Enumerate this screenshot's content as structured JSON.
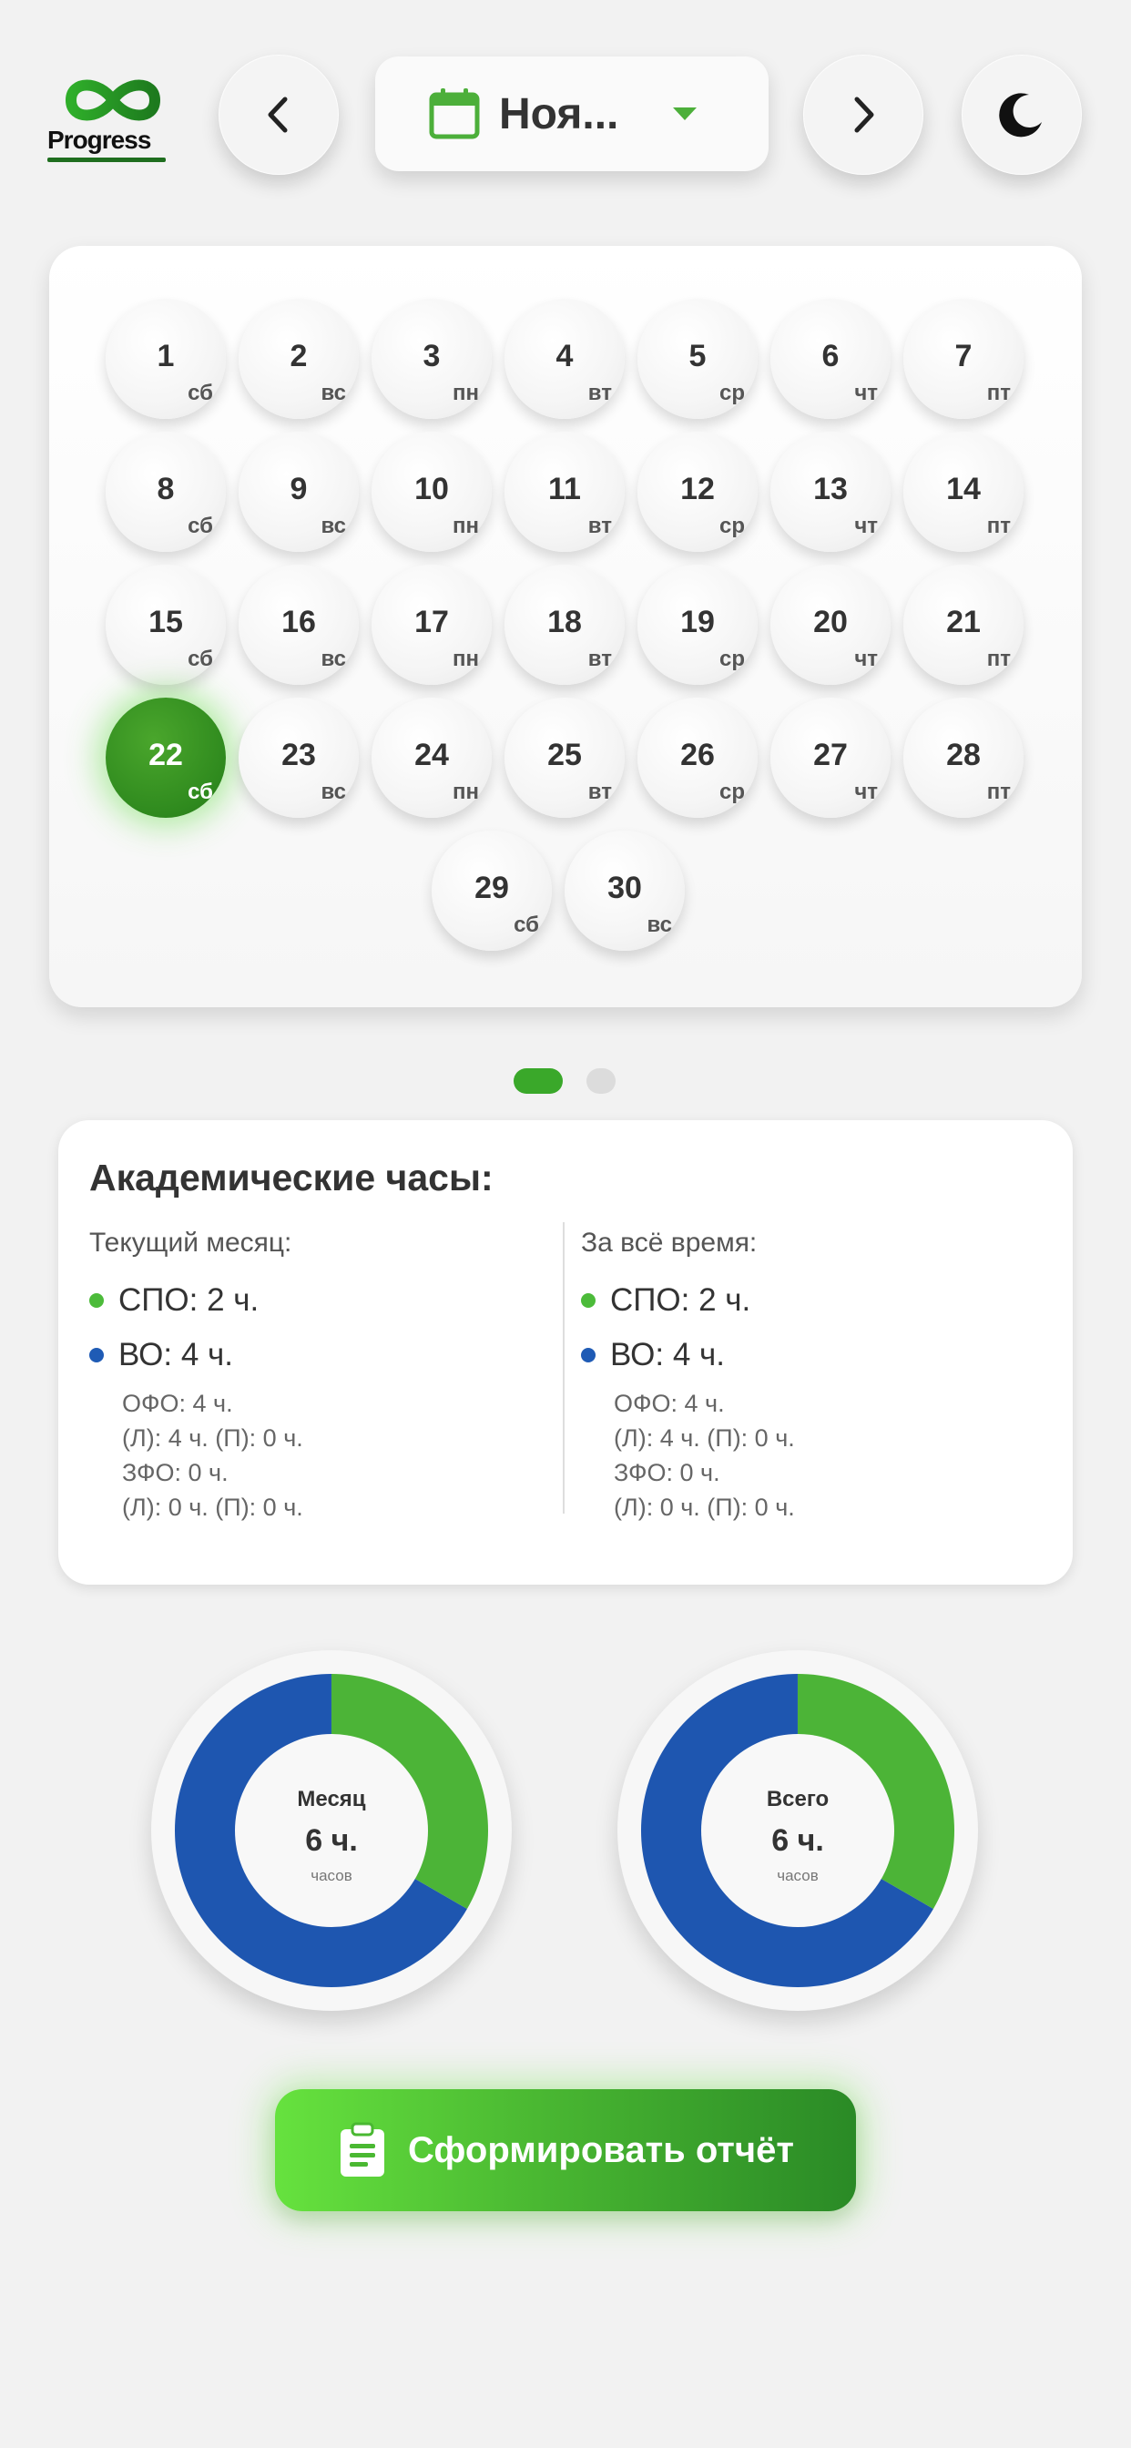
{
  "header": {
    "logo_text": "Progress",
    "month_label": "Ноя...",
    "prev_icon": "chevron-left-icon",
    "next_icon": "chevron-right-icon",
    "theme_icon": "moon-icon",
    "calendar_icon": "calendar-icon",
    "dropdown_icon": "caret-down-icon"
  },
  "calendar": {
    "days": [
      {
        "num": "1",
        "wd": "сб"
      },
      {
        "num": "2",
        "wd": "вс"
      },
      {
        "num": "3",
        "wd": "пн"
      },
      {
        "num": "4",
        "wd": "вт"
      },
      {
        "num": "5",
        "wd": "ср"
      },
      {
        "num": "6",
        "wd": "чт"
      },
      {
        "num": "7",
        "wd": "пт"
      },
      {
        "num": "8",
        "wd": "сб"
      },
      {
        "num": "9",
        "wd": "вс"
      },
      {
        "num": "10",
        "wd": "пн"
      },
      {
        "num": "11",
        "wd": "вт"
      },
      {
        "num": "12",
        "wd": "ср"
      },
      {
        "num": "13",
        "wd": "чт"
      },
      {
        "num": "14",
        "wd": "пт"
      },
      {
        "num": "15",
        "wd": "сб"
      },
      {
        "num": "16",
        "wd": "вс"
      },
      {
        "num": "17",
        "wd": "пн"
      },
      {
        "num": "18",
        "wd": "вт"
      },
      {
        "num": "19",
        "wd": "ср"
      },
      {
        "num": "20",
        "wd": "чт"
      },
      {
        "num": "21",
        "wd": "пт"
      },
      {
        "num": "22",
        "wd": "сб",
        "today": true
      },
      {
        "num": "23",
        "wd": "вс"
      },
      {
        "num": "24",
        "wd": "пн"
      },
      {
        "num": "25",
        "wd": "вт"
      },
      {
        "num": "26",
        "wd": "ср"
      },
      {
        "num": "27",
        "wd": "чт"
      },
      {
        "num": "28",
        "wd": "пт"
      },
      {
        "num": "29",
        "wd": "сб"
      },
      {
        "num": "30",
        "wd": "вс"
      }
    ]
  },
  "pager": {
    "pages": 2,
    "active": 1
  },
  "hours": {
    "title": "Академические часы:",
    "month": {
      "head": "Текущий месяц:",
      "spo": "СПО: 2 ч.",
      "vo": "ВО: 4 ч.",
      "ofo": "ОФО: 4 ч.",
      "ofo_detail": "(Л): 4 ч. (П): 0 ч.",
      "zfo": "ЗФО: 0 ч.",
      "zfo_detail": "(Л): 0 ч. (П): 0 ч."
    },
    "total": {
      "head": "За всё время:",
      "spo": "СПО: 2 ч.",
      "vo": "ВО: 4 ч.",
      "ofo": "ОФО: 4 ч.",
      "ofo_detail": "(Л): 4 ч. (П): 0 ч.",
      "zfo": "ЗФО: 0 ч.",
      "zfo_detail": "(Л): 0 ч. (П): 0 ч."
    }
  },
  "donuts": [
    {
      "label": "Месяц",
      "value": "6 ч.",
      "unit": "часов",
      "spo": 2,
      "vo": 4
    },
    {
      "label": "Всего",
      "value": "6 ч.",
      "unit": "часов",
      "spo": 2,
      "vo": 4
    }
  ],
  "report_button": {
    "label": "Сформировать отчёт",
    "icon": "clipboard-icon"
  },
  "colors": {
    "accent_green": "#3aa82a",
    "blue": "#1e56b0",
    "spo_bullet": "#4cbb3a",
    "vo_bullet": "#1f5bb5"
  }
}
